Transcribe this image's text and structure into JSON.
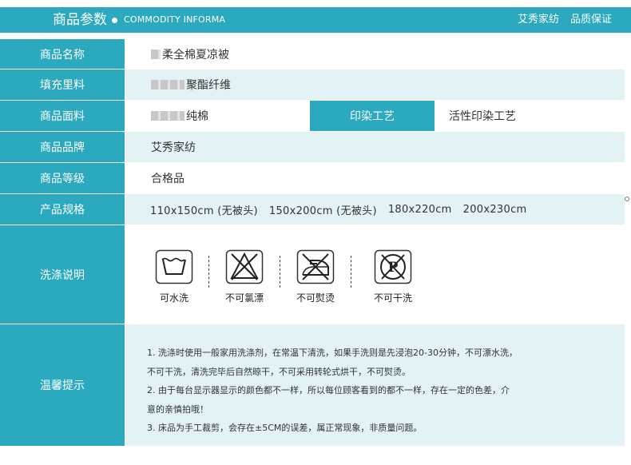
{
  "header": {
    "title": "商品参数",
    "subtitle": "COMMODITY INFORMA",
    "brand": "艾秀家纺",
    "quality": "品质保证"
  },
  "rows": {
    "name": {
      "label": "商品名称",
      "value": "柔全棉夏凉被"
    },
    "filling": {
      "label": "填充里料",
      "value": "聚酯纤维"
    },
    "fabric": {
      "label": "商品面料",
      "value": "纯棉",
      "dye_label": "印染工艺",
      "dye_value": "活性印染工艺"
    },
    "brand": {
      "label": "商品品牌",
      "value": "艾秀家纺"
    },
    "grade": {
      "label": "商品等级",
      "value": "合格品"
    },
    "size": {
      "label": "产品规格",
      "values": [
        "110x150cm (无被头)",
        "150x200cm (无被头)",
        "180x220cm",
        "200x230cm"
      ]
    },
    "wash": {
      "label": "洗涤说明",
      "items": [
        {
          "icon": "hand-wash-icon",
          "text": "可水洗"
        },
        {
          "icon": "no-bleach-icon",
          "text": "不可氯漂"
        },
        {
          "icon": "no-iron-icon",
          "text": "不可熨烫"
        },
        {
          "icon": "no-dry-clean-icon",
          "text": "不可干洗"
        }
      ]
    },
    "tips": {
      "label": "温馨提示",
      "lines": [
        "1. 洗涤时使用一般家用洗涤剂，在常温下清洗，如果手洗则是先浸泡20-30分钟，不可漂水洗，",
        "不可干洗，清洗完毕后自然晾干，不可采用转轮式烘干，不可熨烫。",
        "2. 由于每台显示器显示的颜色都不一样，所以每位顾客看到的都不一样，存在一定的色差，介",
        "意的亲慎拍哦！",
        "3. 床品为手工裁剪，会存在±5CM的误差，属正常现象，非质量问题。"
      ]
    }
  },
  "colors": {
    "accent": "#2aa9bf",
    "row_alt": "#e3f2f5"
  }
}
